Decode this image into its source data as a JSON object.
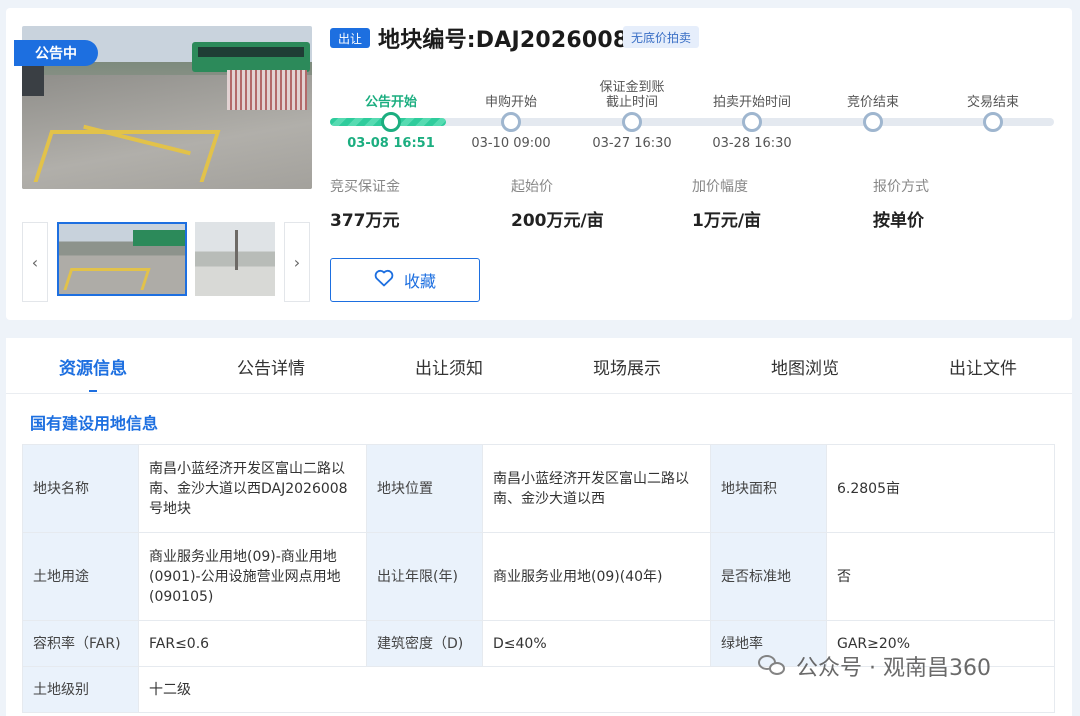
{
  "gallery": {
    "status_badge": "公告中",
    "prev_icon": "chevron-left-icon",
    "next_icon": "chevron-right-icon",
    "prev_glyph": "‹",
    "next_glyph": "›"
  },
  "header": {
    "type_tag": "出让",
    "title": "地块编号:DAJ2026008",
    "reserve_tag": "无底价拍卖"
  },
  "timeline": {
    "progress": 0.16,
    "steps": [
      {
        "label": "公告开始",
        "date": "03-08 16:51",
        "active": true
      },
      {
        "label": "申购开始",
        "date": "03-10 09:00",
        "active": false
      },
      {
        "label": "保证金到账\n截止时间",
        "date": "03-27 16:30",
        "active": false
      },
      {
        "label": "拍卖开始时间",
        "date": "03-28 16:30",
        "active": false
      },
      {
        "label": "竞价结束",
        "date": "",
        "active": false
      },
      {
        "label": "交易结束",
        "date": "",
        "active": false
      }
    ]
  },
  "prices": [
    {
      "label": "竞买保证金",
      "value": "377万元"
    },
    {
      "label": "起始价",
      "value": "200万元/亩"
    },
    {
      "label": "加价幅度",
      "value": "1万元/亩"
    },
    {
      "label": "报价方式",
      "value": "按单价"
    }
  ],
  "favorite": {
    "label": "收藏",
    "icon": "heart-icon"
  },
  "tabs": [
    "资源信息",
    "公告详情",
    "出让须知",
    "现场展示",
    "地图浏览",
    "出让文件"
  ],
  "active_tab": 0,
  "section_title": "国有建设用地信息",
  "land_table": {
    "rows": [
      [
        "地块名称",
        "南昌小蓝经济开发区富山二路以南、金沙大道以西DAJ2026008号地块",
        "地块位置",
        "南昌小蓝经济开发区富山二路以南、金沙大道以西",
        "地块面积",
        "6.2805亩"
      ],
      [
        "土地用途",
        "商业服务业用地(09)-商业用地(0901)-公用设施营业网点用地(090105)",
        "出让年限(年)",
        "商业服务业用地(09)(40年)",
        "是否标准地",
        "否"
      ],
      [
        "容积率（FAR)",
        "FAR≤0.6",
        "建筑密度（D)",
        "D≤40%",
        "绿地率",
        "GAR≥20%"
      ],
      [
        "土地级别",
        "十二级",
        "",
        "",
        "",
        ""
      ]
    ]
  },
  "watermark": "公众号 · 观南昌360",
  "colors": {
    "accent": "#1d6fe0",
    "active_step": "#1cae80"
  }
}
